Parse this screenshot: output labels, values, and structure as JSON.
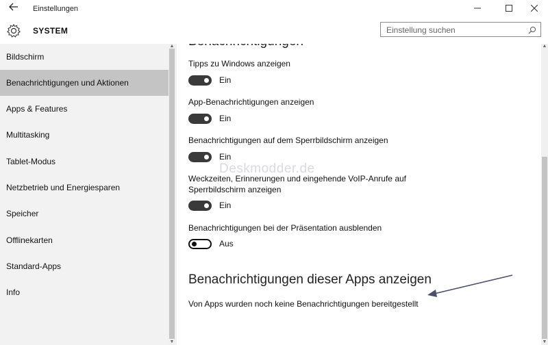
{
  "window": {
    "title": "Einstellungen",
    "back_icon": "back-arrow-icon",
    "minimize_glyph": "—",
    "maximize_glyph": "☐",
    "close_glyph": "✕"
  },
  "header": {
    "title": "SYSTEM",
    "icon": "gear-icon",
    "search_placeholder": "Einstellung suchen"
  },
  "sidebar": {
    "items": [
      {
        "label": "Bildschirm",
        "active": false
      },
      {
        "label": "Benachrichtigungen und Aktionen",
        "active": true
      },
      {
        "label": "Apps & Features",
        "active": false
      },
      {
        "label": "Multitasking",
        "active": false
      },
      {
        "label": "Tablet-Modus",
        "active": false
      },
      {
        "label": "Netzbetrieb und Energiesparen",
        "active": false
      },
      {
        "label": "Speicher",
        "active": false
      },
      {
        "label": "Offlinekarten",
        "active": false
      },
      {
        "label": "Standard-Apps",
        "active": false
      },
      {
        "label": "Info",
        "active": false
      }
    ]
  },
  "content": {
    "section_heading": "Benachrichtigungen",
    "settings": [
      {
        "label": "Tipps zu Windows anzeigen",
        "state": "Ein",
        "on": true
      },
      {
        "label": "App-Benachrichtigungen anzeigen",
        "state": "Ein",
        "on": true
      },
      {
        "label": "Benachrichtigungen auf dem Sperrbildschirm anzeigen",
        "state": "Ein",
        "on": true
      },
      {
        "label_line1": "Weckzeiten, Erinnerungen und eingehende VoIP-Anrufe auf",
        "label_line2": "Sperrbildschirm anzeigen",
        "state": "Ein",
        "on": true
      },
      {
        "label": "Benachrichtigungen bei der Präsentation ausblenden",
        "state": "Aus",
        "on": false
      }
    ],
    "apps_heading": "Benachrichtigungen dieser Apps anzeigen",
    "apps_note": "Von Apps wurden noch keine Benachrichtigungen bereitgestellt"
  },
  "watermark": "Deskmodder.de",
  "colors": {
    "sidebar_bg": "#f2f2f2",
    "active_item_bg": "#c4c4c4",
    "toggle_on": "#3a3a3a",
    "annotation_arrow": "#4a4f6a"
  }
}
